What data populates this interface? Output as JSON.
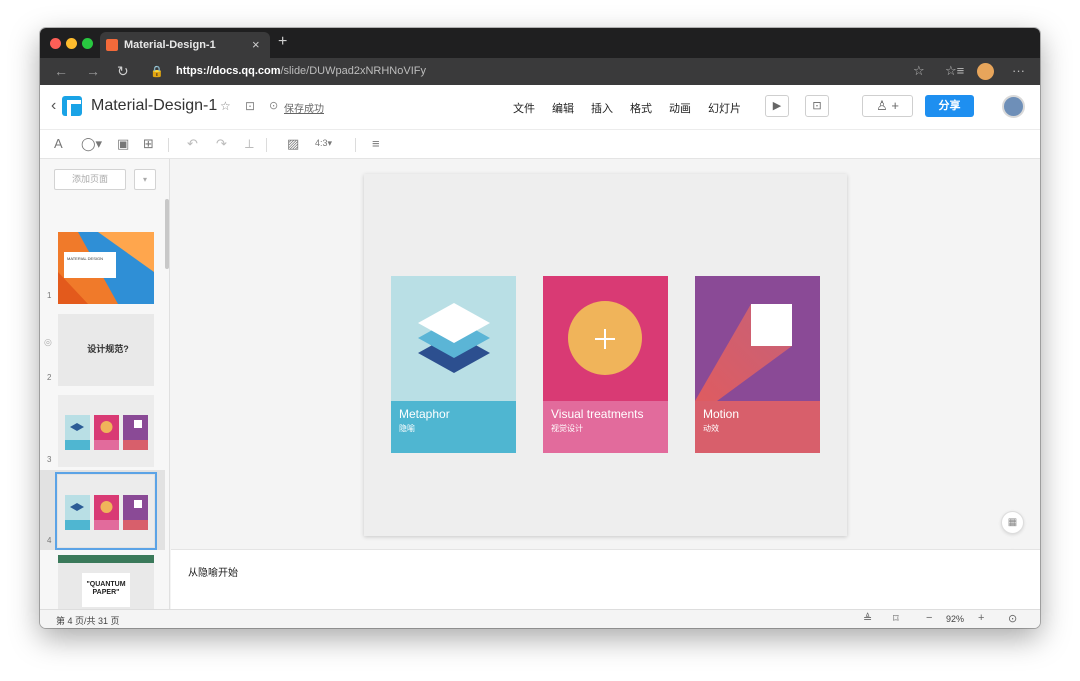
{
  "browser": {
    "tab_title": "Material-Design-1",
    "tab_close": "×",
    "new_tab": "+",
    "url_host": "https://docs.qq.com",
    "url_path": "/slide/DUWpad2xNRHNoVIFy",
    "nav_back": "←",
    "nav_forward": "→",
    "nav_reload": "↻",
    "lock": "🔒",
    "more": "···",
    "star": "☆",
    "favorites": "☆≡"
  },
  "header": {
    "back": "‹",
    "doc_title": "Material-Design-1",
    "star": "☆",
    "folder": "⊡",
    "save_check": "⊙",
    "save_status": "保存成功",
    "menus": [
      "文件",
      "编辑",
      "插入",
      "格式",
      "动画",
      "幻灯片"
    ],
    "present_icon": "▶",
    "present_mode_icon": "⊡",
    "collab_icon": "♙ +",
    "share_label": "分享"
  },
  "toolbar": {
    "icons": [
      "A",
      "◯▾",
      "▣",
      "⊞",
      "↶",
      "↷",
      "⟂",
      "▨",
      "4:3▾",
      "≡"
    ]
  },
  "sidebar": {
    "add_page": "添加页面",
    "add_page_dropdown": "▾",
    "thumbnails": [
      {
        "num": "1",
        "title": "MATERIAL DESIGN"
      },
      {
        "num": "2",
        "title": "设计规范?"
      },
      {
        "num": "3"
      },
      {
        "num": "4"
      },
      {
        "num": "5",
        "title": "\"QUANTUM PAPER\""
      }
    ]
  },
  "slide": {
    "cards": [
      {
        "title": "Metaphor",
        "subtitle": "隐喻"
      },
      {
        "title": "Visual treatments",
        "subtitle": "视觉设计"
      },
      {
        "title": "Motion",
        "subtitle": "动效"
      }
    ]
  },
  "notes": {
    "text": "从隐喻开始"
  },
  "side_buttons": {
    "qr": "▦",
    "help": "?"
  },
  "status": {
    "page_info": "第 4 页/共 31 页",
    "zoom": "92%",
    "zoom_out": "−",
    "zoom_in": "+",
    "play": "⊙"
  },
  "colors": {
    "share_button": "#1e8ff0",
    "metaphor_top": "#b9dfe5",
    "metaphor_bottom": "#4fb6d1",
    "visual_top": "#d93a74",
    "visual_bottom": "#e26b9c",
    "motion_top": "#8a4a96",
    "motion_bottom": "#d85f6b"
  }
}
